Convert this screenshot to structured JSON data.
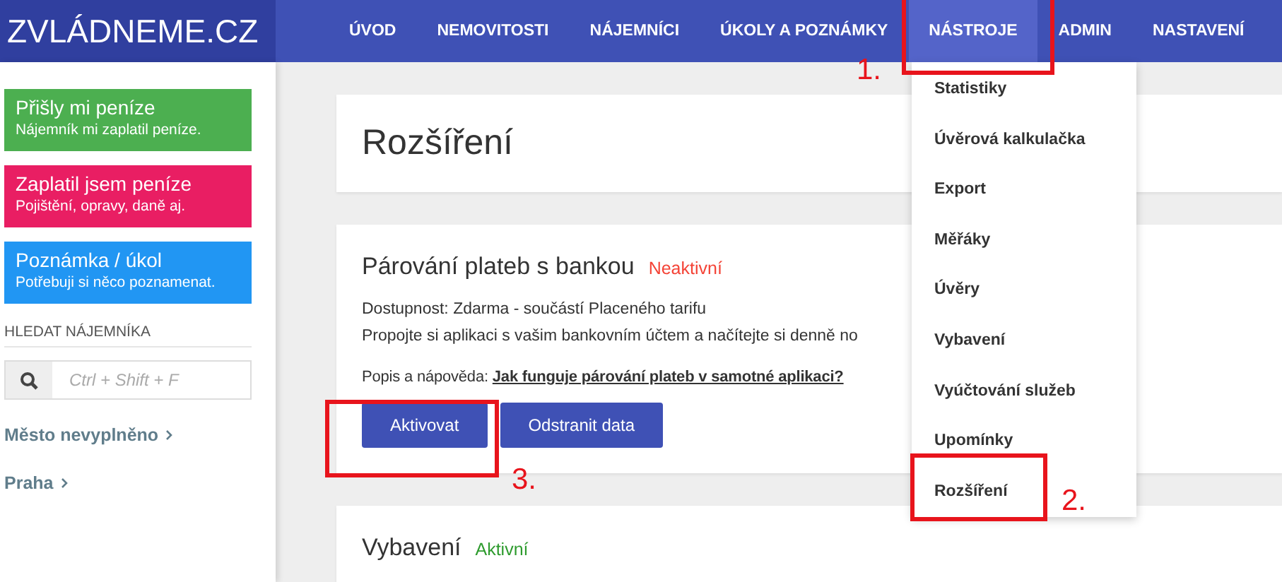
{
  "logo": "ZVLÁDNEME.CZ",
  "nav": [
    {
      "label": "ÚVOD",
      "selected": false
    },
    {
      "label": "NEMOVITOSTI",
      "selected": false
    },
    {
      "label": "NÁJEMNÍCI",
      "selected": false
    },
    {
      "label": "ÚKOLY A POZNÁMKY",
      "selected": false
    },
    {
      "label": "NÁSTROJE",
      "selected": true
    },
    {
      "label": "ADMIN",
      "selected": false
    },
    {
      "label": "NASTAVENÍ",
      "selected": false
    }
  ],
  "quick_actions": [
    {
      "title": "Přišly mi peníze",
      "subtitle": "Nájemník mi zaplatil peníze.",
      "color": "#4caf50"
    },
    {
      "title": "Zaplatil jsem peníze",
      "subtitle": "Pojištění, opravy, daně aj.",
      "color": "#e91e63"
    },
    {
      "title": "Poznámka / úkol",
      "subtitle": "Potřebuji si něco poznamenat.",
      "color": "#2196f3"
    }
  ],
  "search": {
    "heading": "HLEDAT NÁJEMNÍKA",
    "placeholder": "Ctrl + Shift + F"
  },
  "locations": [
    "Město nevyplněno",
    "Praha"
  ],
  "page_title": "Rozšíření",
  "extensions": [
    {
      "name": "Párování plateb s bankou",
      "status": "Neaktivní",
      "active": false,
      "availability": "Dostupnost: Zdarma - součástí Placeného tarifu",
      "description": "Propojte si aplikaci s vašim bankovním účtem a načítejte si denně no",
      "help_label": "Popis a nápověda:",
      "help_link": "Jak funguje párování plateb v samotné aplikaci?",
      "buttons": [
        "Aktivovat",
        "Odstranit data"
      ]
    },
    {
      "name": "Vybavení",
      "status": "Aktivní",
      "active": true
    }
  ],
  "dropdown": [
    "Statistiky",
    "Úvěrová kalkulačka",
    "Export",
    "Měřáky",
    "Úvěry",
    "Vybavení",
    "Vyúčtování služeb",
    "Upomínky",
    "Rozšíření"
  ],
  "annotations": [
    "1.",
    "2.",
    "3."
  ]
}
